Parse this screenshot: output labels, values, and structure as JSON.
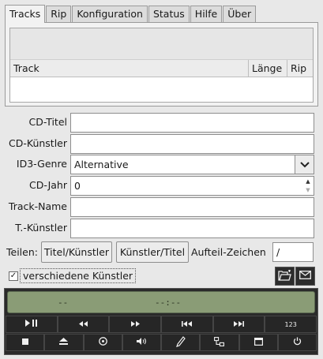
{
  "tabs": [
    "Tracks",
    "Rip",
    "Konfiguration",
    "Status",
    "Hilfe",
    "Über"
  ],
  "track_list": {
    "columns": [
      "Track",
      "Länge",
      "Rip"
    ],
    "rows": []
  },
  "form": {
    "cd_title": {
      "label": "CD-Titel",
      "value": ""
    },
    "cd_artist": {
      "label": "CD-Künstler",
      "value": ""
    },
    "genre": {
      "label": "ID3-Genre",
      "value": "Alternative"
    },
    "year": {
      "label": "CD-Jahr",
      "value": "0"
    },
    "track_name": {
      "label": "Track-Name",
      "value": ""
    },
    "track_artist": {
      "label": "T.-Künstler",
      "value": ""
    }
  },
  "split": {
    "label": "Teilen:",
    "btn_title_artist": "Titel/Künstler",
    "btn_artist_title": "Künstler/Titel",
    "separator_label": "Aufteil-Zeichen",
    "separator_value": "/"
  },
  "various_artists": {
    "label": "verschiedene Künstler",
    "checked": true,
    "mark": "✓"
  },
  "icons": {
    "open_folder": "folder-open-icon",
    "email": "email-icon"
  },
  "player": {
    "display_track": "--",
    "display_time": "--:--",
    "display_color": "#8a9c76",
    "row1": [
      {
        "name": "play-pause-button",
        "icon": "play-pause-icon"
      },
      {
        "name": "rewind-button",
        "icon": "rewind-icon"
      },
      {
        "name": "fast-forward-button",
        "icon": "fast-forward-icon"
      },
      {
        "name": "previous-track-button",
        "icon": "skip-back-icon"
      },
      {
        "name": "next-track-button",
        "icon": "skip-forward-icon"
      },
      {
        "name": "track-number-button",
        "label": "123"
      }
    ],
    "row2": [
      {
        "name": "stop-button",
        "icon": "stop-icon"
      },
      {
        "name": "eject-button",
        "icon": "eject-icon"
      },
      {
        "name": "cd-button",
        "icon": "cd-icon"
      },
      {
        "name": "volume-button",
        "icon": "volume-icon"
      },
      {
        "name": "edit-button",
        "icon": "pencil-icon"
      },
      {
        "name": "network-button",
        "icon": "network-icon"
      },
      {
        "name": "window-button",
        "icon": "window-icon"
      },
      {
        "name": "power-button",
        "icon": "power-icon"
      }
    ]
  }
}
